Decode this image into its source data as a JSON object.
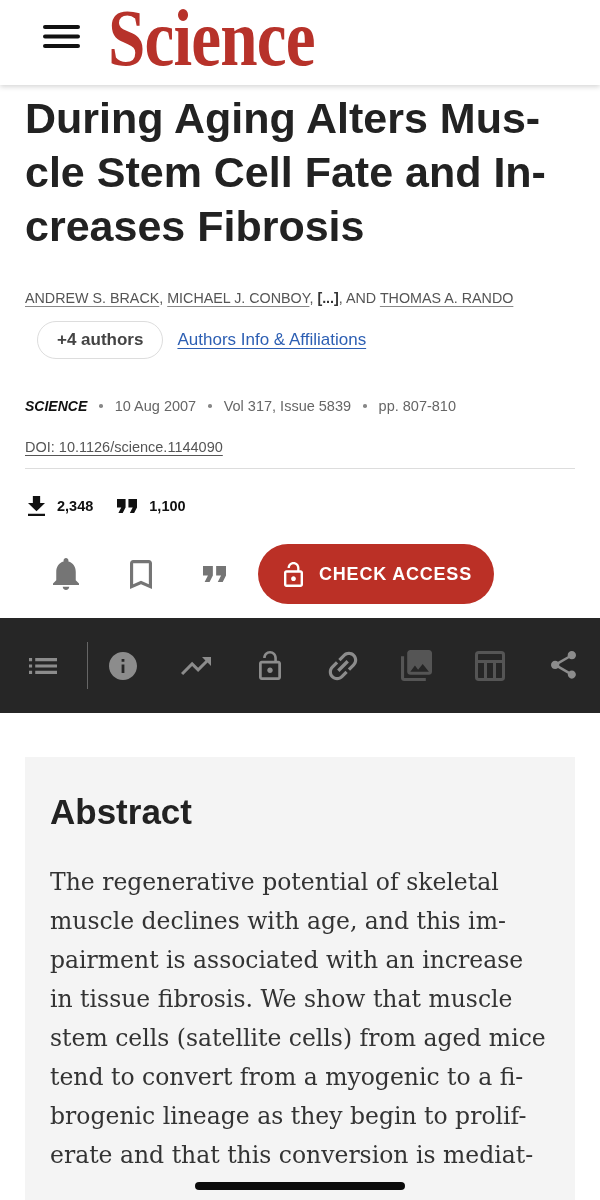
{
  "header": {
    "logo": "Science"
  },
  "article": {
    "title_lines": [
      "During Aging Alters Mus-",
      "cle Stem Cell Fate and In-",
      "creases Fibrosis"
    ],
    "authors": [
      {
        "kind": "link",
        "text": "ANDREW S. BRACK"
      },
      {
        "kind": "text",
        "text": ", "
      },
      {
        "kind": "link",
        "text": "MICHAEL J. CONBOY"
      },
      {
        "kind": "text",
        "text": ", "
      },
      {
        "kind": "more",
        "text": "[...]"
      },
      {
        "kind": "text",
        "text": ", AND "
      },
      {
        "kind": "link",
        "text": "THOMAS A. RANDO"
      }
    ],
    "more_authors_button": "+4 authors",
    "affiliations_link": "Authors Info & Affiliations",
    "journal": "SCIENCE",
    "meta": [
      "10 Aug 2007",
      "Vol 317, Issue 5839",
      "pp. 807-810"
    ],
    "doi": "DOI: 10.1126/science.1144090"
  },
  "metrics": [
    {
      "kind": "downloads",
      "value": "2,348"
    },
    {
      "kind": "citations",
      "value": "1,100"
    }
  ],
  "actions": [
    {
      "kind": "alert"
    },
    {
      "kind": "bookmark"
    },
    {
      "kind": "cite"
    }
  ],
  "access_button": {
    "label": "CHECK ACCESS"
  },
  "toolbar": [
    {
      "kind": "outline",
      "disabled": false
    },
    {
      "kind": "info",
      "disabled": false
    },
    {
      "kind": "metrics",
      "disabled": false
    },
    {
      "kind": "access",
      "disabled": false
    },
    {
      "kind": "link",
      "disabled": false
    },
    {
      "kind": "figures",
      "disabled": true
    },
    {
      "kind": "tables",
      "disabled": true
    },
    {
      "kind": "share",
      "disabled": false
    }
  ],
  "abstract": {
    "heading": "Abstract",
    "lines": [
      "The regenerative potential of skeletal",
      "muscle declines with age, and this im-",
      "pairment is associated with an increase",
      "in tissue fibrosis. We show that muscle",
      "stem cells (satellite cells) from aged mice",
      "tend to convert from a myogenic to a fi-",
      "brogenic lineage as they begin to prolif-",
      "erate and that this conversion is mediat-"
    ]
  }
}
